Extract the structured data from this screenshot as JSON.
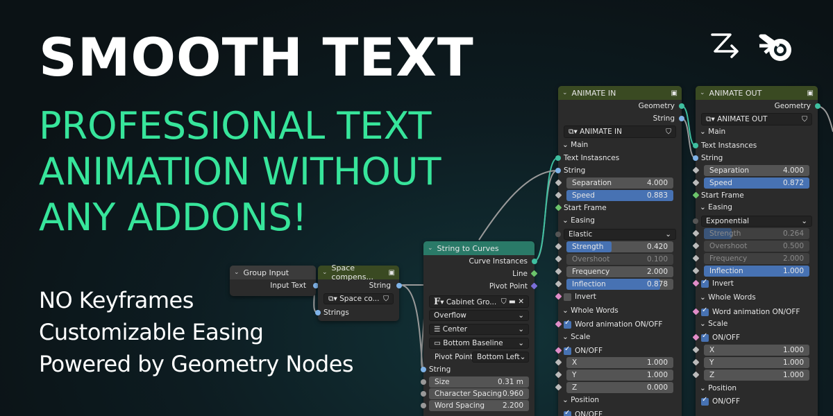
{
  "headline": "SMOOTH TEXT",
  "subheadline": [
    "PROFESSIONAL TEXT",
    "ANIMATION WITHOUT",
    "ANY ADDONS!"
  ],
  "features": [
    "NO Keyframes",
    "Customizable Easing",
    "Powered by Geometry Nodes"
  ],
  "colors": {
    "accent": "#37e59b",
    "header_input": "#3b3b3b",
    "header_group": "#3a4a22",
    "header_curve": "#2a7a68",
    "select_blue": "#4772b3"
  },
  "icons": [
    "arrow-curve-logo",
    "blender-logo"
  ],
  "nodes": {
    "group_input": {
      "title": "Group Input",
      "out_label": "Input Text"
    },
    "space_comp": {
      "title": "Space compens...",
      "out_label": "String",
      "datablock": "Space co...",
      "in_label": "Strings"
    },
    "string_to_curves": {
      "title": "String to Curves",
      "outputs": [
        "Curve Instances",
        "Line",
        "Pivot Point"
      ],
      "font": "Cabinet Gro...",
      "overflow": "Overflow",
      "align_x": "Center",
      "align_y": "Bottom Baseline",
      "pivot_label": "Pivot Point",
      "pivot_value": "Bottom Left",
      "string_label": "String",
      "fields": [
        {
          "label": "Size",
          "value": "0.31 m"
        },
        {
          "label": "Character Spacing",
          "value": "0.960"
        },
        {
          "label": "Word Spacing",
          "value": "2.200"
        }
      ]
    },
    "animate_in": {
      "title": "ANIMATE IN",
      "out_geometry": "Geometry",
      "out_string": "String",
      "datablock": "ANIMATE IN",
      "panel_main": "Main",
      "in_text": "Text Instasnces",
      "in_string": "String",
      "separation": {
        "label": "Separation",
        "value": "4.000"
      },
      "speed": {
        "label": "Speed",
        "value": "0.883"
      },
      "start_frame": "Start Frame",
      "panel_easing": "Easing",
      "easing": "Elastic",
      "strength": {
        "label": "Strength",
        "value": "0.420"
      },
      "overshoot": {
        "label": "Overshoot",
        "value": "0.100"
      },
      "frequency": {
        "label": "Frequency",
        "value": "2.000"
      },
      "inflection": {
        "label": "Inflection",
        "value": "0.878"
      },
      "invert": "Invert",
      "panel_words": "Whole Words",
      "word_anim": "Word animation ON/OFF",
      "panel_scale": "Scale",
      "onoff": "ON/OFF",
      "x": {
        "label": "X",
        "value": "1.000"
      },
      "y": {
        "label": "Y",
        "value": "1.000"
      },
      "z": {
        "label": "Z",
        "value": "0.000"
      },
      "panel_position": "Position",
      "onoff2": "ON/OFF"
    },
    "animate_out": {
      "title": "ANIMATE OUT",
      "out_geometry": "Geometry",
      "datablock": "ANIMATE OUT",
      "panel_main": "Main",
      "in_text": "Text Instasnces",
      "in_string": "String",
      "separation": {
        "label": "Separation",
        "value": "4.000"
      },
      "speed": {
        "label": "Speed",
        "value": "0.872"
      },
      "start_frame": "Start Frame",
      "panel_easing": "Easing",
      "easing": "Exponential",
      "strength": {
        "label": "Strength",
        "value": "0.264"
      },
      "overshoot": {
        "label": "Overshoot",
        "value": "0.500"
      },
      "frequency": {
        "label": "Frequency",
        "value": "2.000"
      },
      "inflection": {
        "label": "Inflection",
        "value": "1.000"
      },
      "invert": "Invert",
      "panel_words": "Whole Words",
      "word_anim": "Word animation ON/OFF",
      "panel_scale": "Scale",
      "onoff": "ON/OFF",
      "x": {
        "label": "X",
        "value": "1.000"
      },
      "y": {
        "label": "Y",
        "value": "1.000"
      },
      "z": {
        "label": "Z",
        "value": "1.000"
      },
      "panel_position": "Position",
      "onoff2": "ON/OFF"
    }
  }
}
